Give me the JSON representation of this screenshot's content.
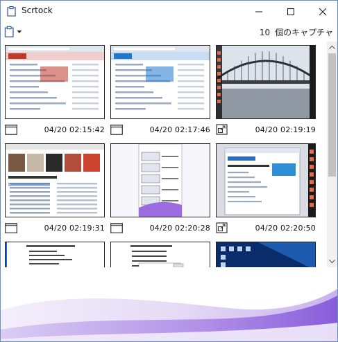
{
  "window": {
    "title": "Scrtock",
    "icon": "clipboard-icon",
    "controls": [
      "minimize-icon",
      "maximize-icon",
      "close-icon"
    ]
  },
  "toolbar": {
    "capture_icon": "clipboard-icon",
    "dropdown_icon": "caret-down-icon",
    "count_value": "10",
    "count_label": "個のキャプチャ"
  },
  "captures": [
    {
      "time": "04/20 02:15:42",
      "kind": "window-icon",
      "thumb": "web-page-vector"
    },
    {
      "time": "04/20 02:17:46",
      "kind": "window-icon",
      "thumb": "web-page-freesoft"
    },
    {
      "time": "04/20 02:19:19",
      "kind": "region-icon",
      "thumb": "desktop-bridge"
    },
    {
      "time": "04/20 02:19:31",
      "kind": "window-icon",
      "thumb": "media-library"
    },
    {
      "time": "04/20 02:20:28",
      "kind": "window-icon",
      "thumb": "scrtock-window"
    },
    {
      "time": "04/20 02:20:50",
      "kind": "region-icon",
      "thumb": "desktop-browser"
    },
    {
      "time": "",
      "kind": "",
      "thumb": "dialog-text"
    },
    {
      "time": "",
      "kind": "",
      "thumb": "dialog-settings"
    },
    {
      "time": "",
      "kind": "",
      "thumb": "desktop-blue"
    }
  ],
  "colors": {
    "accent": "#7b4fd6",
    "wave_light": "#e9e2f7",
    "wave_dark": "#8a5ddb",
    "scroll_thumb": "#c2c2c2"
  }
}
